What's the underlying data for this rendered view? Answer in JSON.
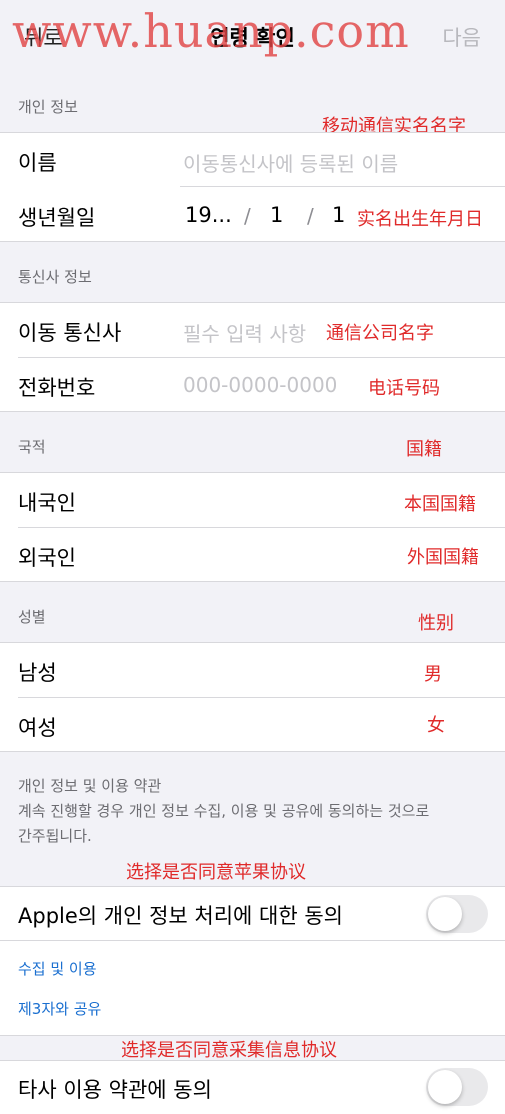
{
  "nav": {
    "back_label": "뒤로",
    "title": "연령 확인",
    "next_label": "다음"
  },
  "watermark": "www.huanp.com",
  "personal_section": {
    "header": "개인 정보",
    "annotation": "移动通信实名名字",
    "name_label": "이름",
    "name_placeholder": "이동통신사에 등록된 이름",
    "birth_label": "생년월일",
    "birth_year": "19...",
    "birth_sep": "/",
    "birth_month": "1",
    "birth_day": "1",
    "birth_annotation": "实名出生年月日"
  },
  "carrier_section": {
    "header": "통신사 정보",
    "carrier_label": "이동 통신사",
    "carrier_placeholder": "필수 입력 사항",
    "carrier_annotation": "通信公司名字",
    "phone_label": "전화번호",
    "phone_placeholder": "000-0000-0000",
    "phone_annotation": "电话号码"
  },
  "nationality_section": {
    "header": "국적",
    "header_annotation": "国籍",
    "options": [
      {
        "label": "내국인",
        "annotation": "本国国籍"
      },
      {
        "label": "외국인",
        "annotation": "外国国籍"
      }
    ]
  },
  "gender_section": {
    "header": "성별",
    "header_annotation": "性别",
    "options": [
      {
        "label": "남성",
        "annotation": "男"
      },
      {
        "label": "여성",
        "annotation": "女"
      }
    ]
  },
  "terms_section": {
    "title": "개인 정보 및 이용 약관",
    "description_line1": "계속 진행할 경우 개인 정보 수집, 이용 및 공유에 동의하는 것으로",
    "description_line2": "간주됩니다.",
    "apple_annotation": "选择是否同意苹果协议",
    "apple_consent_label": "Apple의 개인 정보 처리에 대한 동의",
    "apple_consent_on": false,
    "link_collection": "수집 및 이용",
    "link_third_party": "제3자와 공유",
    "thirdparty_annotation": "选择是否同意采集信息协议",
    "thirdparty_consent_label": "타사 이용 약관에 동의",
    "thirdparty_consent_on": false
  }
}
